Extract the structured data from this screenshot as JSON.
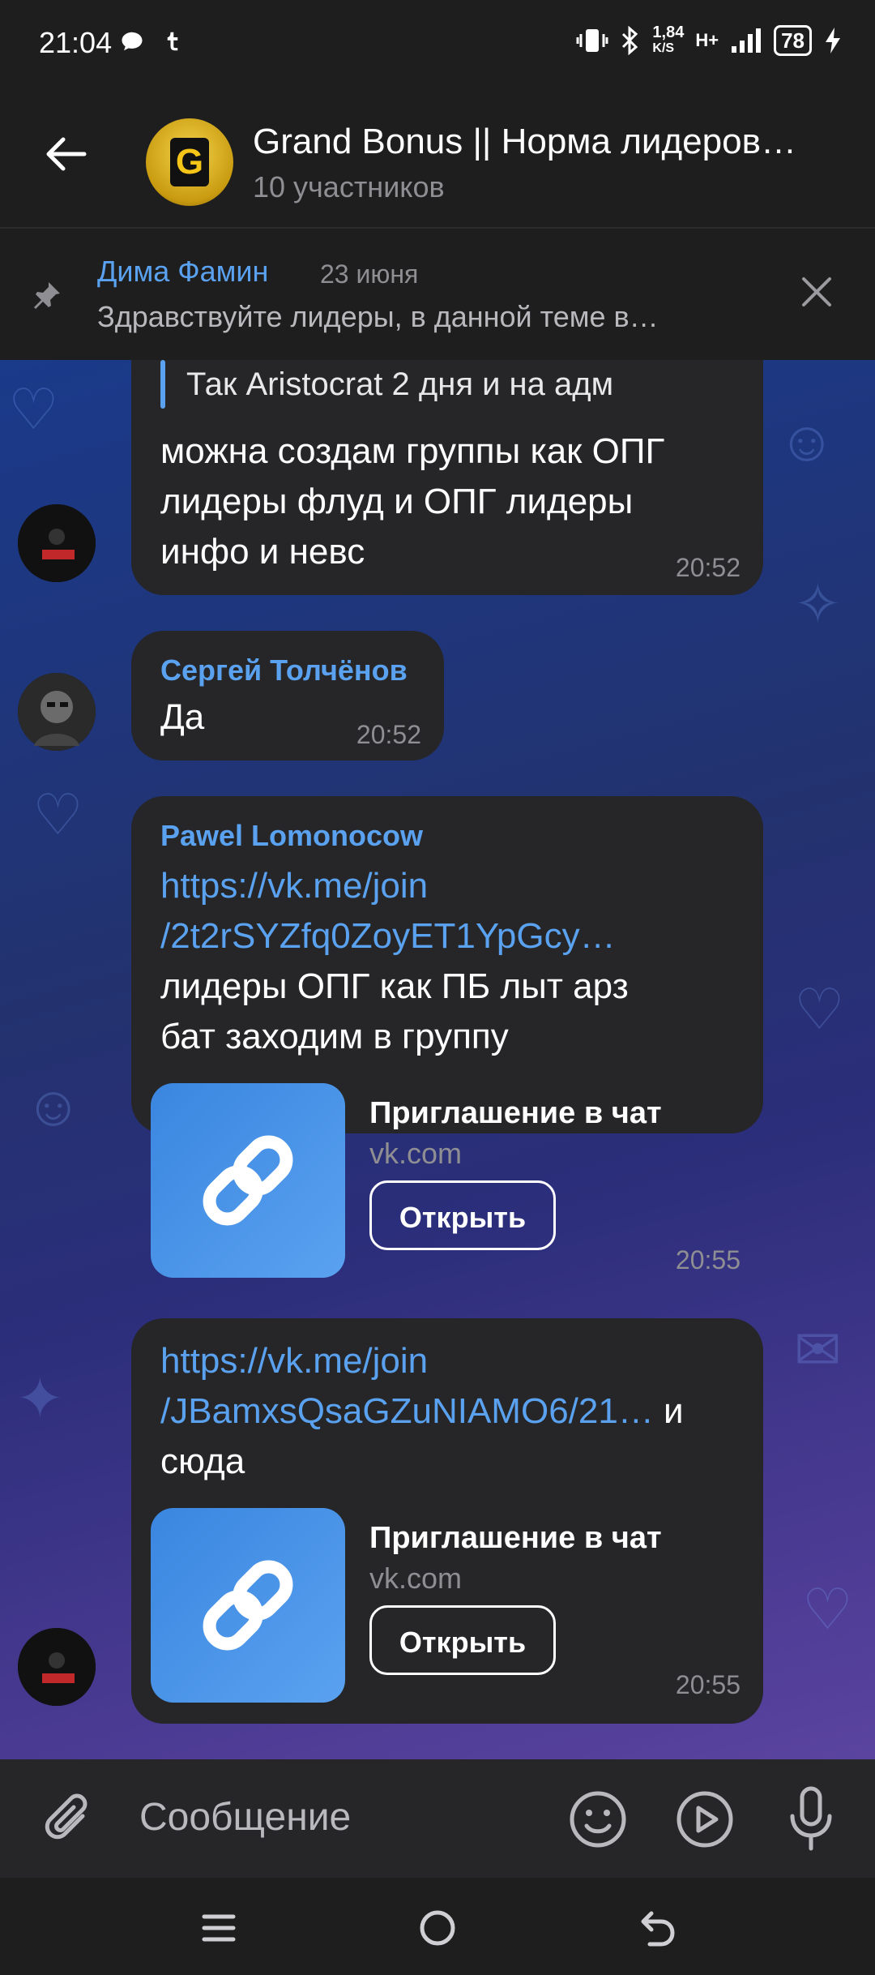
{
  "status_bar": {
    "time": "21:04",
    "speed_value": "1,84",
    "speed_unit": "K/S",
    "network": "H+",
    "battery": "78"
  },
  "header": {
    "title": "Grand Bonus || Норма лидеров…",
    "subtitle": "10 участников",
    "avatar_letter": "G"
  },
  "pinned": {
    "author": "Дима Фамин",
    "date": "23 июня",
    "text": "Здравствуйте лидеры, в данной теме в…"
  },
  "messages": [
    {
      "reply_text": "Так Aristocrat  2 дня и на адм",
      "lines": [
        "можна создам группы как ОПГ",
        "лидеры флуд и ОПГ лидеры",
        "инфо и невс"
      ],
      "time": "20:52"
    },
    {
      "author": "Сергей Толчёнов",
      "text": "Да",
      "time": "20:52"
    },
    {
      "author": "Pawel Lomonocow",
      "link_line1": "https://vk.me/join",
      "link_line2": "/2t2rSYZfq0ZoyET1YpGcy…",
      "line3": "лидеры ОПГ как ПБ лыт арз",
      "line4": "бат заходим в группу",
      "preview_title": "Приглашение в чат",
      "preview_site": "vk.com",
      "button": "Открыть",
      "time": "20:55"
    },
    {
      "link_line1": "https://vk.me/join",
      "link_line2": "/JBamxsQsaGZuNIAMO6/21…",
      "link_tail": " и",
      "line3": "сюда",
      "preview_title": "Приглашение в чат",
      "preview_site": "vk.com",
      "button": "Открыть",
      "time": "20:55"
    }
  ],
  "input": {
    "placeholder": "Сообщение"
  },
  "colors": {
    "accent": "#5aa2f0",
    "bubble": "#262628",
    "background": "#1e1e1f"
  }
}
